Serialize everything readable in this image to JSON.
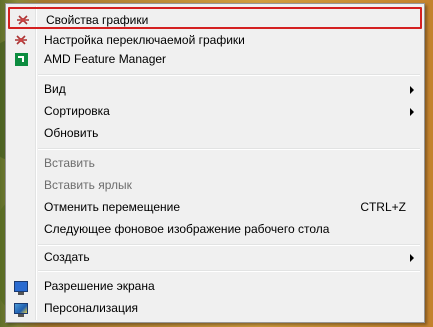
{
  "menu": {
    "items": [
      {
        "label": "Свойства графики",
        "icon": "graphics-driver-icon",
        "highlighted": true
      },
      {
        "label": "Настройка переключаемой графики",
        "icon": "graphics-driver-icon"
      },
      {
        "label": "AMD Feature Manager",
        "icon": "amd-icon"
      },
      {
        "label": "Вид",
        "submenu": true
      },
      {
        "label": "Сортировка",
        "submenu": true
      },
      {
        "label": "Обновить"
      },
      {
        "label": "Вставить",
        "disabled": true
      },
      {
        "label": "Вставить ярлык",
        "disabled": true
      },
      {
        "label": "Отменить перемещение",
        "shortcut": "CTRL+Z"
      },
      {
        "label": "Следующее фоновое изображение рабочего стола"
      },
      {
        "label": "Создать",
        "submenu": true
      },
      {
        "label": "Разрешение экрана",
        "icon": "screen-resolution-icon"
      },
      {
        "label": "Персонализация",
        "icon": "personalization-icon"
      }
    ]
  },
  "colors": {
    "highlight_border": "#d42020",
    "menu_bg": "#f0f0f0",
    "disabled_text": "#6d6d6d"
  }
}
